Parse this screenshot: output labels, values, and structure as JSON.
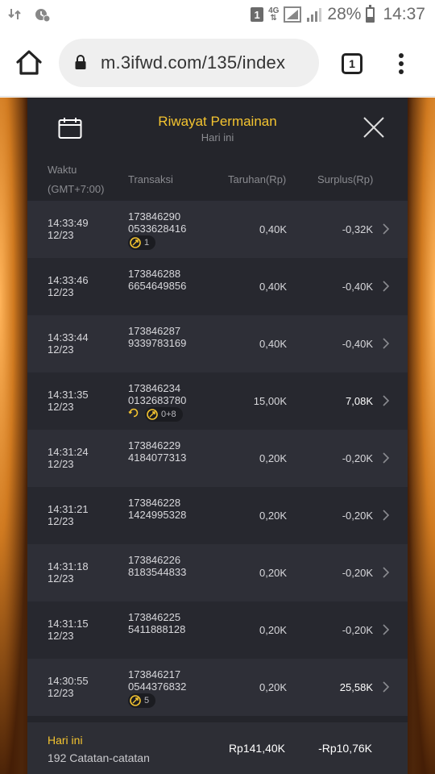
{
  "status_bar": {
    "sim_label": "1",
    "network_label": "4G",
    "battery_percent": "28%",
    "battery_level": 0.28,
    "time": "14:37"
  },
  "browser": {
    "url": "m.3ifwd.com/135/index",
    "tab_count": "1"
  },
  "panel": {
    "title": "Riwayat Permainan",
    "subtitle": "Hari ini",
    "columns": {
      "time_line1": "Waktu",
      "time_line2": "(GMT+7:00)",
      "transaction": "Transaksi",
      "bet": "Taruhan(Rp)",
      "surplus": "Surplus(Rp)"
    },
    "rows": [
      {
        "time": "14:33:49",
        "date": "12/23",
        "trans1": "173846290",
        "trans2": "0533628416",
        "badge": "1",
        "badge_type": "single",
        "bet": "0,40K",
        "surplus": "-0,32K",
        "positive": false
      },
      {
        "time": "14:33:46",
        "date": "12/23",
        "trans1": "173846288",
        "trans2": "6654649856",
        "badge": "",
        "badge_type": "none",
        "bet": "0,40K",
        "surplus": "-0,40K",
        "positive": false
      },
      {
        "time": "14:33:44",
        "date": "12/23",
        "trans1": "173846287",
        "trans2": "9339783169",
        "badge": "",
        "badge_type": "none",
        "bet": "0,40K",
        "surplus": "-0,40K",
        "positive": false
      },
      {
        "time": "14:31:35",
        "date": "12/23",
        "trans1": "173846234",
        "trans2": "0132683780",
        "badge": "0+8",
        "badge_type": "double",
        "bet": "15,00K",
        "surplus": "7,08K",
        "positive": true
      },
      {
        "time": "14:31:24",
        "date": "12/23",
        "trans1": "173846229",
        "trans2": "4184077313",
        "badge": "",
        "badge_type": "none",
        "bet": "0,20K",
        "surplus": "-0,20K",
        "positive": false
      },
      {
        "time": "14:31:21",
        "date": "12/23",
        "trans1": "173846228",
        "trans2": "1424995328",
        "badge": "",
        "badge_type": "none",
        "bet": "0,20K",
        "surplus": "-0,20K",
        "positive": false
      },
      {
        "time": "14:31:18",
        "date": "12/23",
        "trans1": "173846226",
        "trans2": "8183544833",
        "badge": "",
        "badge_type": "none",
        "bet": "0,20K",
        "surplus": "-0,20K",
        "positive": false
      },
      {
        "time": "14:31:15",
        "date": "12/23",
        "trans1": "173846225",
        "trans2": "5411888128",
        "badge": "",
        "badge_type": "none",
        "bet": "0,20K",
        "surplus": "-0,20K",
        "positive": false
      },
      {
        "time": "14:30:55",
        "date": "12/23",
        "trans1": "173846217",
        "trans2": "0544376832",
        "badge": "5",
        "badge_type": "single",
        "bet": "0,20K",
        "surplus": "25,58K",
        "positive": true
      }
    ],
    "footer": {
      "today": "Hari ini",
      "count": "192 Catatan-catatan",
      "total_bet": "Rp141,40K",
      "total_surplus": "-Rp10,76K"
    }
  },
  "colors": {
    "accent": "#f4c430",
    "panel_bg": "#24252b",
    "row_odd": "#2e2f37",
    "row_even": "#27282f",
    "muted_text": "#8a8b90"
  },
  "icons": {
    "home": "home-icon",
    "lock": "lock-icon",
    "menu": "more-vert-icon",
    "calendar": "calendar-icon",
    "close": "close-icon",
    "chevron": "chevron-right-icon",
    "free_spin": "free-spin-icon",
    "respin": "respin-icon"
  }
}
